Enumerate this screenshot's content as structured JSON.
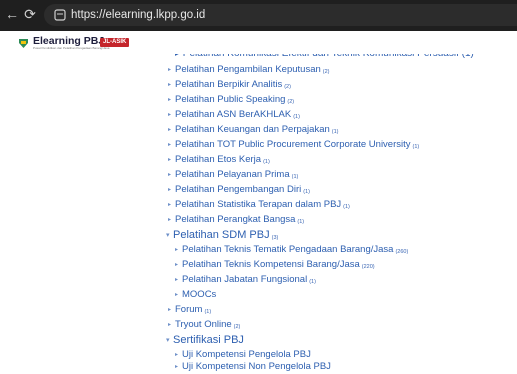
{
  "browser": {
    "url": "https://elearning.lkpp.go.id"
  },
  "header": {
    "logo_title": "Elearning PBJ",
    "logo_subtitle": "Pusat Pendidikan dan Pelatihan Pengadaan Barang/Jasa",
    "logo_badge": "JL-ASIK"
  },
  "tree": {
    "items": [
      {
        "label": "Pelatihan Pengambilan Keputusan",
        "count": "(2)"
      },
      {
        "label": "Pelatihan Berpikir Analitis",
        "count": "(2)"
      },
      {
        "label": "Pelatihan Public Speaking",
        "count": "(2)"
      },
      {
        "label": "Pelatihan ASN BerAKHLAK",
        "count": "(1)"
      },
      {
        "label": "Pelatihan Keuangan dan Perpajakan",
        "count": "(1)"
      },
      {
        "label": "Pelatihan TOT Public Procurement Corporate University",
        "count": "(1)"
      },
      {
        "label": "Pelatihan Etos Kerja",
        "count": "(1)"
      },
      {
        "label": "Pelatihan Pelayanan Prima",
        "count": "(1)"
      },
      {
        "label": "Pelatihan Pengembangan Diri",
        "count": "(1)"
      },
      {
        "label": "Pelatihan Statistika Terapan dalam PBJ",
        "count": "(1)"
      },
      {
        "label": "Pelatihan Perangkat Bangsa",
        "count": "(1)"
      }
    ],
    "sdm": {
      "label": "Pelatihan SDM PBJ",
      "count": "(3)",
      "children": [
        {
          "label": "Pelatihan Teknis Tematik Pengadaan Barang/Jasa",
          "count": "(260)"
        },
        {
          "label": "Pelatihan Teknis Kompetensi Barang/Jasa",
          "count": "(220)"
        },
        {
          "label": "Pelatihan Jabatan Fungsional",
          "count": "(1)"
        },
        {
          "label": "MOOCs",
          "count": ""
        }
      ]
    },
    "forum": {
      "label": "Forum",
      "count": "(1)"
    },
    "tryout": {
      "label": "Tryout Online",
      "count": "(2)"
    },
    "sertifikasi": {
      "label": "Sertifikasi PBJ",
      "children": [
        {
          "label": "Uji Kompetensi Pengelola PBJ"
        },
        {
          "label": "Uji Kompetensi Non Pengelola PBJ"
        }
      ]
    }
  }
}
